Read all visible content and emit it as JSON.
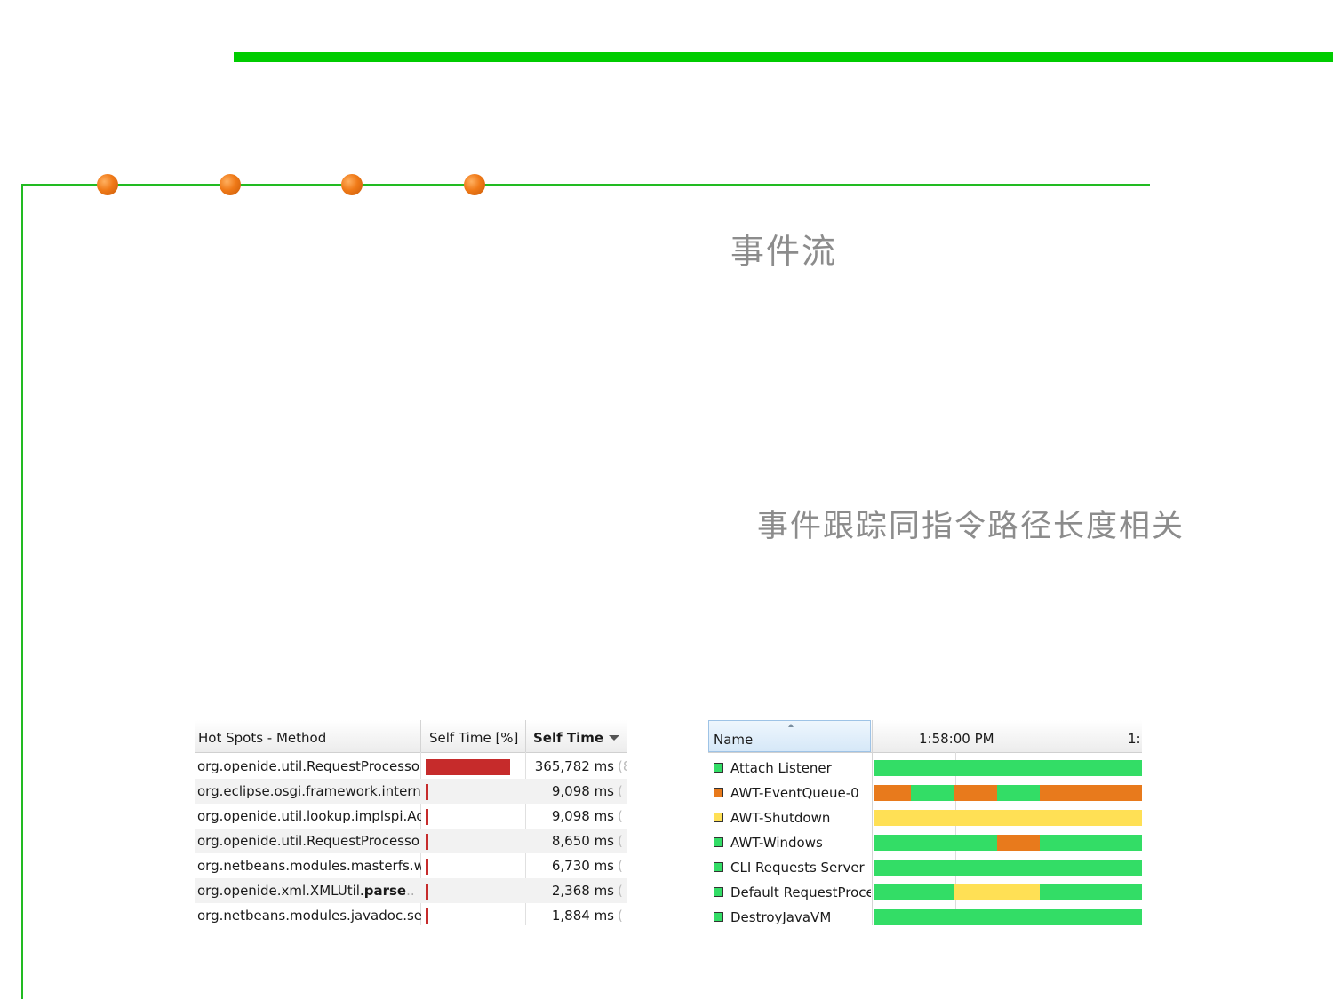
{
  "slide": {
    "title": "事件流",
    "subtitle": "事件跟踪同指令路径长度相关"
  },
  "colors": {
    "accent_green": "#00cc00",
    "bullet_orange": "#f07a18",
    "hotspot_bar": "#c62b2b",
    "thread_running": "#33dd66",
    "thread_wait": "#e87a1c",
    "thread_sleep": "#ffe055"
  },
  "hotspots": {
    "headers": {
      "method": "Hot Spots - Method",
      "percent": "Self Time [%]",
      "time": "Self Time"
    },
    "rows": [
      {
        "method": "org.openide.util.RequestProcesso",
        "percent": 92,
        "time": "365,782 ms",
        "clip": "(8"
      },
      {
        "method": "org.eclipse.osgi.framework.intern",
        "percent": 2.3,
        "time": "9,098 ms",
        "clip": "("
      },
      {
        "method": "org.openide.util.lookup.implspi.Ac",
        "percent": 2.3,
        "time": "9,098 ms",
        "clip": "("
      },
      {
        "method": "org.openide.util.RequestProcesso",
        "percent": 2.2,
        "time": "8,650 ms",
        "clip": "("
      },
      {
        "method": "org.netbeans.modules.masterfs.w",
        "percent": 1.7,
        "time": "6,730 ms",
        "clip": "("
      },
      {
        "method_pre": "org.openide.xml.XMLUtil.",
        "method_bold": "parse",
        "method_post": "..",
        "percent": 0.6,
        "time": "2,368 ms",
        "clip": "("
      },
      {
        "method": "org.netbeans.modules.javadoc.se",
        "percent": 0.5,
        "time": "1,884 ms",
        "clip": "("
      }
    ]
  },
  "threads": {
    "headers": {
      "name": "Name",
      "time1": "1:58:00 PM",
      "time2": "1:"
    },
    "rows": [
      {
        "name": "Attach Listener",
        "color": "#33dd66",
        "segments": [
          {
            "from": 0,
            "to": 1,
            "color": "#33dd66"
          }
        ]
      },
      {
        "name": "AWT-EventQueue-0",
        "color": "#e87a1c",
        "segments": [
          {
            "from": 0,
            "to": 0.14,
            "color": "#e87a1c"
          },
          {
            "from": 0.14,
            "to": 0.3,
            "color": "#33dd66"
          },
          {
            "from": 0.3,
            "to": 0.46,
            "color": "#e87a1c"
          },
          {
            "from": 0.46,
            "to": 0.62,
            "color": "#33dd66"
          },
          {
            "from": 0.62,
            "to": 1,
            "color": "#e87a1c"
          }
        ]
      },
      {
        "name": "AWT-Shutdown",
        "color": "#ffe055",
        "segments": [
          {
            "from": 0,
            "to": 1,
            "color": "#ffe055"
          }
        ]
      },
      {
        "name": "AWT-Windows",
        "color": "#33dd66",
        "segments": [
          {
            "from": 0,
            "to": 0.46,
            "color": "#33dd66"
          },
          {
            "from": 0.46,
            "to": 0.62,
            "color": "#e87a1c"
          },
          {
            "from": 0.62,
            "to": 1,
            "color": "#33dd66"
          }
        ]
      },
      {
        "name": "CLI Requests Server",
        "color": "#33dd66",
        "segments": [
          {
            "from": 0,
            "to": 1,
            "color": "#33dd66"
          }
        ]
      },
      {
        "name": "Default RequestProce",
        "color": "#33dd66",
        "segments": [
          {
            "from": 0,
            "to": 0.3,
            "color": "#33dd66"
          },
          {
            "from": 0.3,
            "to": 0.62,
            "color": "#ffe055"
          },
          {
            "from": 0.62,
            "to": 1,
            "color": "#33dd66"
          }
        ]
      },
      {
        "name": "DestroyJavaVM",
        "color": "#33dd66",
        "segments": [
          {
            "from": 0,
            "to": 1,
            "color": "#33dd66"
          }
        ]
      }
    ]
  }
}
